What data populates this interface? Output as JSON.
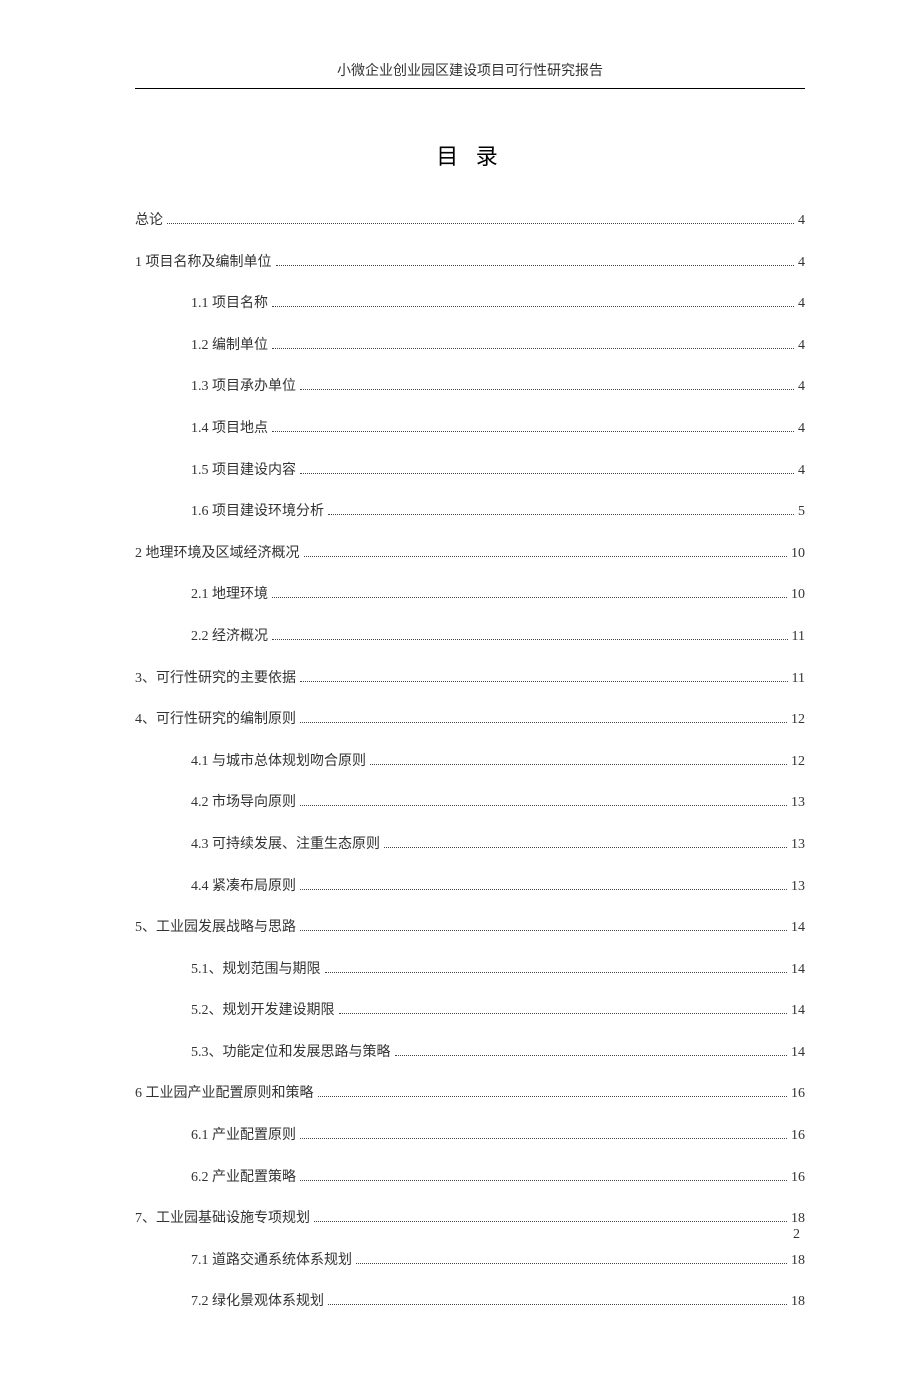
{
  "header": {
    "title": "小微企业创业园区建设项目可行性研究报告"
  },
  "toc": {
    "title": "目 录",
    "entries": [
      {
        "level": 1,
        "label": "总论",
        "page": "4"
      },
      {
        "level": 1,
        "label": "1 项目名称及编制单位",
        "page": "4"
      },
      {
        "level": 2,
        "label": "1.1 项目名称",
        "page": "4"
      },
      {
        "level": 2,
        "label": "1.2 编制单位",
        "page": "4"
      },
      {
        "level": 2,
        "label": "1.3 项目承办单位",
        "page": "4"
      },
      {
        "level": 2,
        "label": "1.4 项目地点",
        "page": "4"
      },
      {
        "level": 2,
        "label": "1.5 项目建设内容",
        "page": "4"
      },
      {
        "level": 2,
        "label": "1.6 项目建设环境分析",
        "page": "5"
      },
      {
        "level": 1,
        "label": "2  地理环境及区域经济概况",
        "page": "10"
      },
      {
        "level": 2,
        "label": "2.1 地理环境",
        "page": "10"
      },
      {
        "level": 2,
        "label": "2.2 经济概况",
        "page": "11"
      },
      {
        "level": 1,
        "label": "3、可行性研究的主要依据",
        "page": "11"
      },
      {
        "level": 1,
        "label": "4、可行性研究的编制原则",
        "page": "12"
      },
      {
        "level": 2,
        "label": "4.1 与城市总体规划吻合原则",
        "page": "12"
      },
      {
        "level": 2,
        "label": "4.2 市场导向原则",
        "page": "13"
      },
      {
        "level": 2,
        "label": "4.3 可持续发展、注重生态原则",
        "page": "13"
      },
      {
        "level": 2,
        "label": "4.4 紧凑布局原则",
        "page": "13"
      },
      {
        "level": 1,
        "label": "5、工业园发展战略与思路",
        "page": "14"
      },
      {
        "level": 2,
        "label": "5.1、规划范围与期限",
        "page": "14"
      },
      {
        "level": 2,
        "label": "5.2、规划开发建设期限",
        "page": "14"
      },
      {
        "level": 2,
        "label": "5.3、功能定位和发展思路与策略",
        "page": "14"
      },
      {
        "level": 1,
        "label": "6  工业园产业配置原则和策略",
        "page": "16"
      },
      {
        "level": 2,
        "label": "6.1 产业配置原则",
        "page": "16"
      },
      {
        "level": 2,
        "label": "6.2  产业配置策略",
        "page": "16"
      },
      {
        "level": 1,
        "label": "7、工业园基础设施专项规划",
        "page": "18"
      },
      {
        "level": 2,
        "label": "7.1 道路交通系统体系规划",
        "page": "18"
      },
      {
        "level": 2,
        "label": "7.2 绿化景观体系规划",
        "page": "18"
      }
    ]
  },
  "pageNumber": "2"
}
